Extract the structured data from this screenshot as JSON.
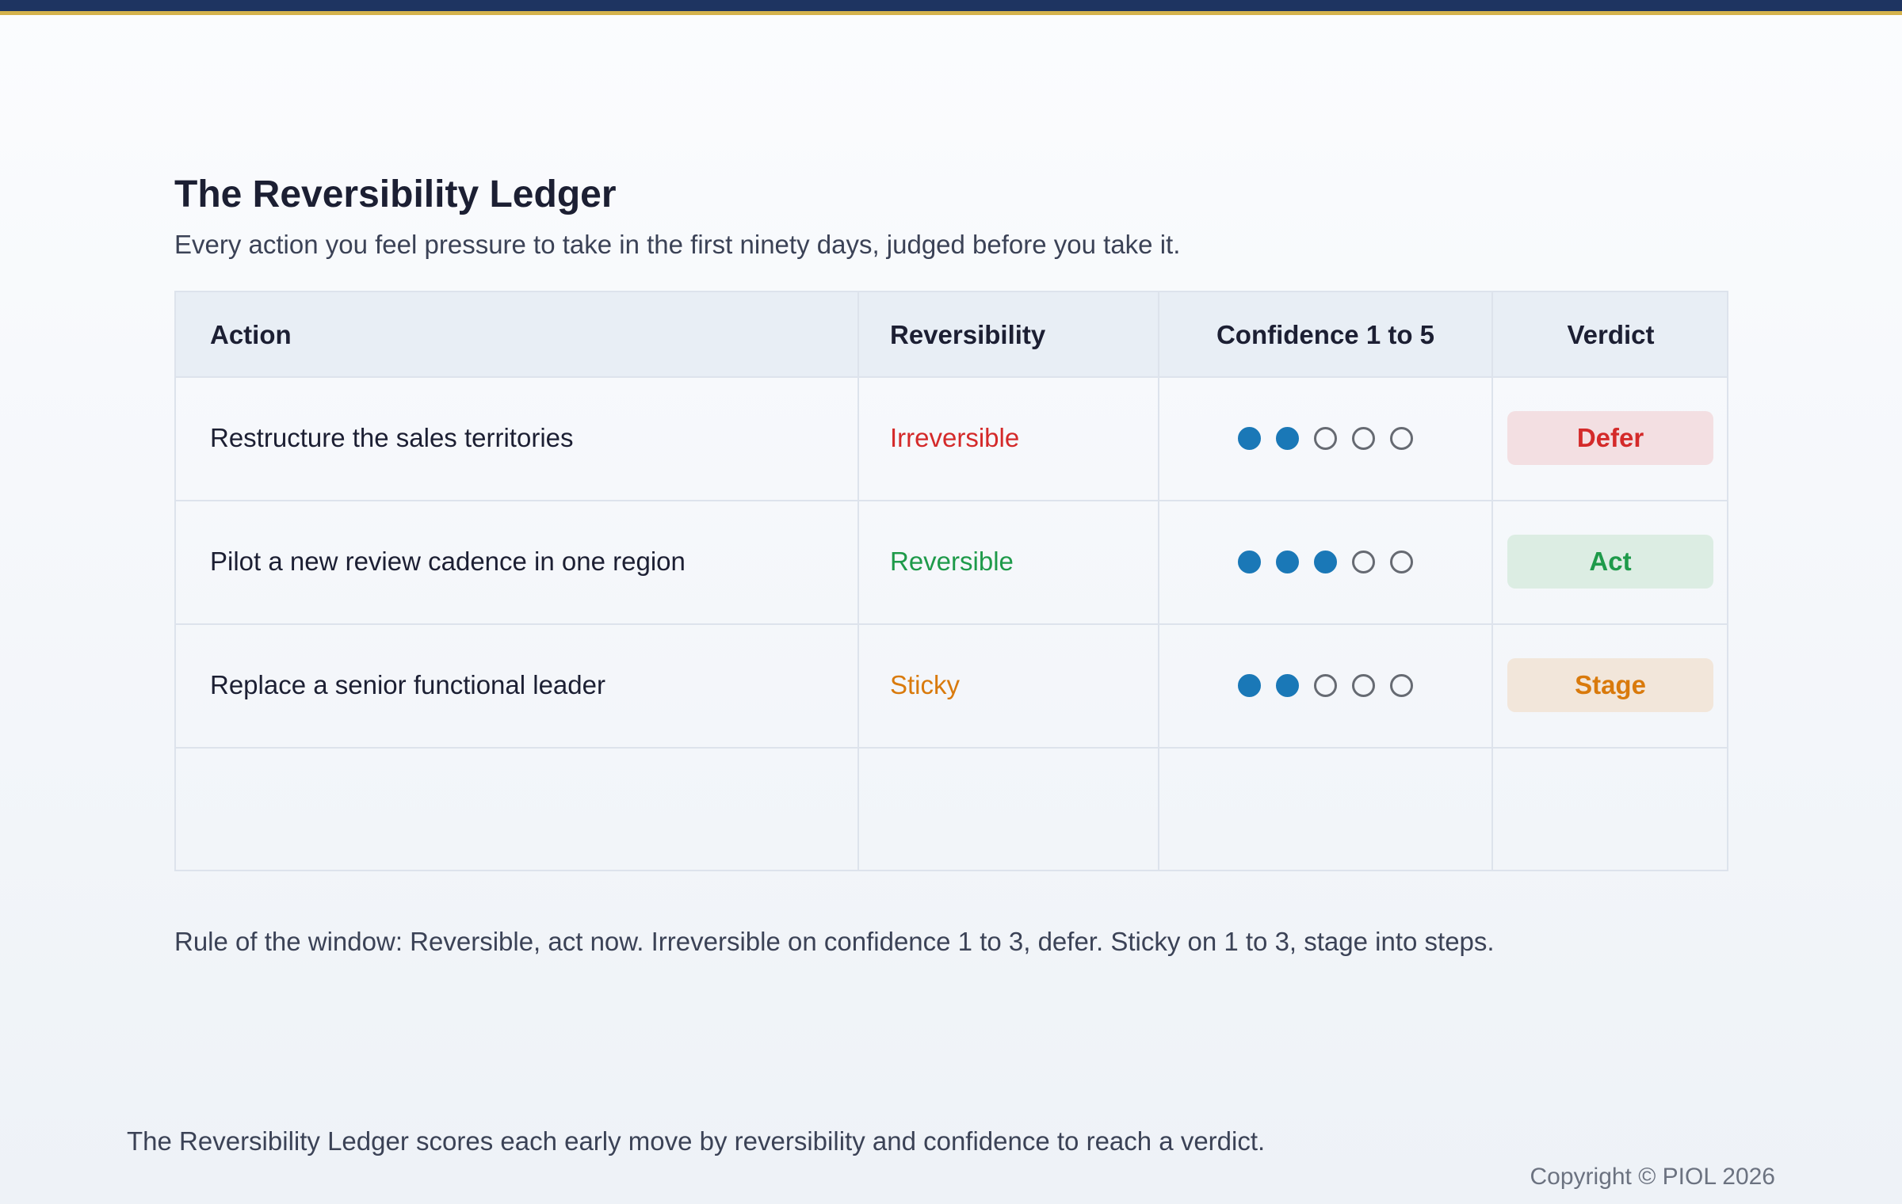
{
  "title": "The Reversibility Ledger",
  "subtitle": "Every action you feel pressure to take in the first ninety days, judged before you take it.",
  "table": {
    "headers": {
      "action": "Action",
      "reversibility": "Reversibility",
      "confidence": "Confidence 1 to 5",
      "verdict": "Verdict"
    },
    "rows": [
      {
        "action": "Restructure the sales territories",
        "reversibility": "Irreversible",
        "reversibility_color": "#d42a2a",
        "confidence": 2,
        "confidence_max": 5,
        "verdict": "Defer",
        "verdict_color": "#d42a2a",
        "verdict_bg": "#f3dfe2"
      },
      {
        "action": "Pilot a new review cadence in one region",
        "reversibility": "Reversible",
        "reversibility_color": "#1e9a4a",
        "confidence": 3,
        "confidence_max": 5,
        "verdict": "Act",
        "verdict_color": "#1e9a4a",
        "verdict_bg": "#dcede3"
      },
      {
        "action": "Replace a senior functional leader",
        "reversibility": "Sticky",
        "reversibility_color": "#d97a0c",
        "confidence": 2,
        "confidence_max": 5,
        "verdict": "Stage",
        "verdict_color": "#d97a0c",
        "verdict_bg": "#f2e6da"
      }
    ],
    "dot_color": "#1a78b7"
  },
  "rule": "Rule of the window: Reversible, act now. Irreversible on confidence 1 to 3, defer. Sticky on 1 to 3, stage into steps.",
  "caption": "The Reversibility Ledger scores each early move by reversibility and confidence to reach a verdict.",
  "copyright": "Copyright © PIOL 2026",
  "colors": {
    "top_bar": "#1e3461",
    "top_bar_accent": "#d4b24c"
  }
}
